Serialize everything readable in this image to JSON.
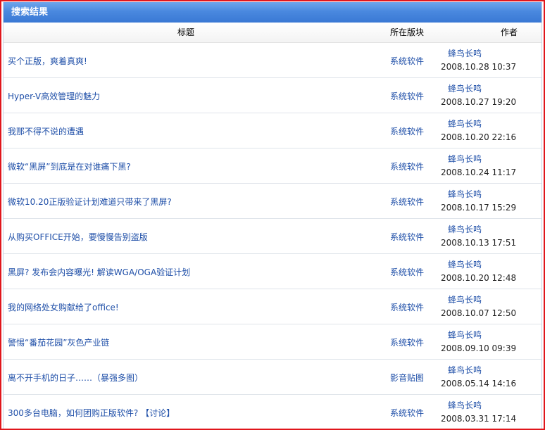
{
  "panel": {
    "title": "搜索结果"
  },
  "columns": {
    "title": "标题",
    "board": "所在版块",
    "author": "作者"
  },
  "results": [
    {
      "title": "买个正版，爽着真爽!",
      "board": "系统软件",
      "author": "蜂鸟长鸣",
      "datetime": "2008.10.28 10:37"
    },
    {
      "title": "Hyper-V高效管理的魅力",
      "board": "系统软件",
      "author": "蜂鸟长鸣",
      "datetime": "2008.10.27 19:20"
    },
    {
      "title": "我那不得不说的遭遇",
      "board": "系统软件",
      "author": "蜂鸟长鸣",
      "datetime": "2008.10.20 22:16"
    },
    {
      "title": "微软“黑屏”到底是在对谁痛下黑?",
      "board": "系统软件",
      "author": "蜂鸟长鸣",
      "datetime": "2008.10.24 11:17"
    },
    {
      "title": "微软10.20正版验证计划难道只带来了黑屏?",
      "board": "系统软件",
      "author": "蜂鸟长鸣",
      "datetime": "2008.10.17 15:29"
    },
    {
      "title": "从购买OFFICE开始，要慢慢告别盗版",
      "board": "系统软件",
      "author": "蜂鸟长鸣",
      "datetime": "2008.10.13 17:51"
    },
    {
      "title": "黑屏? 发布会内容曝光! 解读WGA/OGA验证计划",
      "board": "系统软件",
      "author": "蜂鸟长鸣",
      "datetime": "2008.10.20 12:48"
    },
    {
      "title": "我的网络处女购献给了office!",
      "board": "系统软件",
      "author": "蜂鸟长鸣",
      "datetime": "2008.10.07 12:50"
    },
    {
      "title": "警惕“番茄花园”灰色产业链",
      "board": "系统软件",
      "author": "蜂鸟长鸣",
      "datetime": "2008.09.10 09:39"
    },
    {
      "title": "离不开手机的日子……（暴强多图）",
      "board": "影音贴图",
      "author": "蜂鸟长鸣",
      "datetime": "2008.05.14 14:16"
    },
    {
      "title": "300多台电脑，如何团购正版软件? 【讨论】",
      "board": "系统软件",
      "author": "蜂鸟长鸣",
      "datetime": "2008.03.31 17:14"
    }
  ]
}
